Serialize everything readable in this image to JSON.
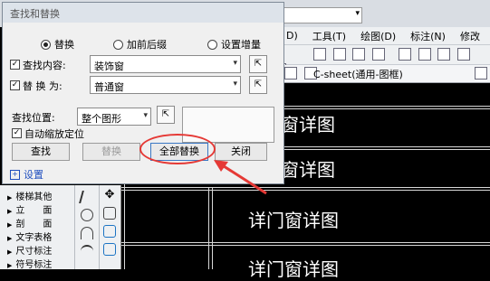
{
  "dialog": {
    "title": "查找和替换",
    "mode_options": [
      "替换",
      "加前后缀",
      "设置增量"
    ],
    "selected_mode": "替换",
    "find_label": "查找内容:",
    "find_value": "装饰窗",
    "replace_label": "替 换 为:",
    "replace_value": "普通窗",
    "scope_label": "查找位置:",
    "scope_value": "整个图形",
    "auto_zoom_label": "自动缩放定位",
    "buttons": {
      "find": "查找",
      "replace": "替换",
      "replace_all": "全部替换",
      "close": "关闭"
    },
    "settings_label": "设置",
    "settings_expander": "+"
  },
  "app": {
    "menu": [
      "D)",
      "工具(T)",
      "绘图(D)",
      "标注(N)",
      "修改"
    ],
    "sheet_tab": "C-sheet(通用-图框)"
  },
  "left_panel": {
    "items": [
      "楼梯其他",
      "立　　面",
      "剖　　面",
      "文字表格",
      "尺寸标注",
      "符号标注"
    ]
  },
  "drawing": {
    "texts": [
      "窗详图",
      "窗详图",
      "详门窗详图",
      "详门窗详图"
    ]
  },
  "colors": {
    "highlight": "#e53935",
    "link": "#1f4fbf"
  }
}
